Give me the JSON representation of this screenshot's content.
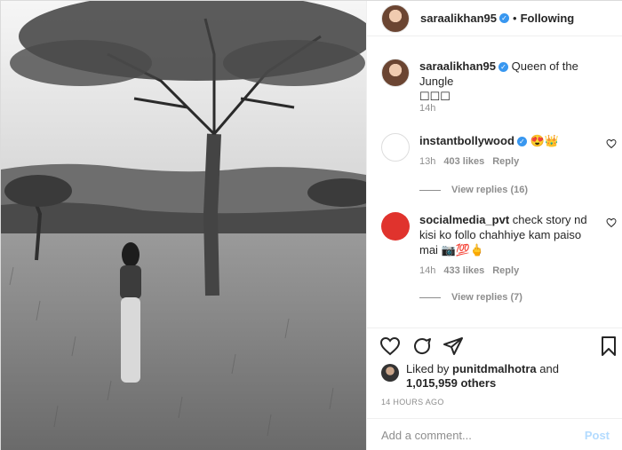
{
  "header": {
    "username": "saraalikhan95",
    "separator": "•",
    "follow_status": "Following"
  },
  "caption": {
    "username": "saraalikhan95",
    "text": "Queen of the Jungle",
    "emoji_line": "☐☐☐",
    "time": "14h"
  },
  "comments": [
    {
      "username": "instantbollywood",
      "text": "😍👑",
      "time": "13h",
      "likes": "403 likes",
      "reply": "Reply",
      "view_replies": "View replies (16)"
    },
    {
      "username": "socialmedia_pvt",
      "text": "check story nd kisi ko follo chahhiye kam paiso mai 📷💯🖕",
      "time": "14h",
      "likes": "433 likes",
      "reply": "Reply",
      "view_replies": "View replies (7)"
    }
  ],
  "likes": {
    "prefix": "Liked by",
    "liker": "punitdmalhotra",
    "and": "and",
    "others": "1,015,959 others"
  },
  "posted": "14 HOURS AGO",
  "add_comment": {
    "placeholder": "Add a comment...",
    "post_label": "Post"
  },
  "icons": [
    "heart-icon",
    "comment-icon",
    "share-icon",
    "bookmark-icon",
    "verified-icon"
  ],
  "colors": {
    "verified": "#3897f0",
    "post_disabled": "#b3dbff",
    "muted": "#8e8e8e"
  }
}
